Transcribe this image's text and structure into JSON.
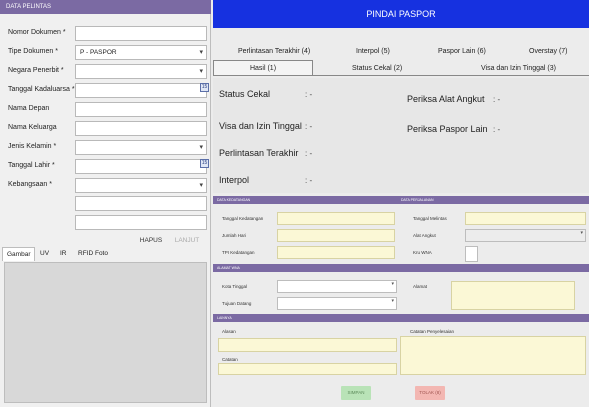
{
  "left_panel": {
    "header": "DATA PELINTAS",
    "fields": [
      {
        "label": "Nomor Dokumen *",
        "value": ""
      },
      {
        "label": "Tipe Dokumen *",
        "value": "P - PASPOR"
      },
      {
        "label": "Negara Penerbit *",
        "value": ""
      },
      {
        "label": "Tanggal Kadaluarsa *",
        "value": ""
      },
      {
        "label": "Nama Depan",
        "value": ""
      },
      {
        "label": "Nama Keluarga",
        "value": ""
      },
      {
        "label": "Jenis Kelamin *",
        "value": ""
      },
      {
        "label": "Tanggal Lahir *",
        "value": ""
      },
      {
        "label": "Kebangsaan *",
        "value": ""
      }
    ],
    "calendar_icon": "calendar-icon",
    "hapus_label": "HAPUS",
    "lanjut_label": "LANJUT",
    "image_tabs": [
      "Gambar",
      "UV",
      "IR",
      "RFID Foto"
    ]
  },
  "main": {
    "title": "PINDAI PASPOR",
    "tabs_row1": [
      "Perlintasan Terakhir (4)",
      "Interpol (5)",
      "Paspor Lain (6)",
      "Overstay (7)"
    ],
    "tabs_row2": [
      "Hasil (1)",
      "Status Cekal (2)",
      "Visa dan Izin Tinggal (3)"
    ],
    "status": {
      "cekal_label": "Status Cekal",
      "cekal_value": ": -",
      "visa_label": "Visa dan Izin Tinggal",
      "visa_value": ": -",
      "perlintasan_label": "Perlintasan Terakhir",
      "perlintasan_value": ": -",
      "interpol_label": "Interpol",
      "interpol_value": ": -",
      "alat_angkut_label": "Periksa Alat Angkut",
      "alat_angkut_value": ": -",
      "paspor_lain_label": "Periksa Paspor Lain",
      "paspor_lain_value": ": -"
    },
    "kedatangan_section": {
      "header": "DATA KEDATANGAN",
      "tanggal_label": "Tanggal Kedatangan",
      "jumlah_label": "Jumlah Hari",
      "tpi_label": "TPI Kedatangan"
    },
    "perjalanan_section": {
      "header": "DATA PERJALANAN",
      "melintas_label": "Tanggal Melintas",
      "alat_label": "Alat Angkut",
      "wna_label": "Kru WNA"
    },
    "alamat_section": {
      "header": "ALAMAT WNA",
      "kota_label": "Kota Tinggal",
      "tujuan_label": "Tujuan Datang",
      "alamat_label": "Alamat"
    },
    "lainnya_section": {
      "header": "LAINNYA",
      "alasan_label": "Alasan",
      "catatan_label": "Catatan",
      "catatan_penyelesaian_label": "Catatan Penyelesaian"
    },
    "buttons": {
      "simpan": "SIMPAN",
      "tolak": "TOLAK (8)"
    }
  },
  "colors": {
    "title_bar": "#1631e0",
    "section_header": "#7b6aa3",
    "input_yellow": "#fbf8d6",
    "simpan_green": "#b9e3b7",
    "tolak_pink": "#f3b7b2"
  }
}
